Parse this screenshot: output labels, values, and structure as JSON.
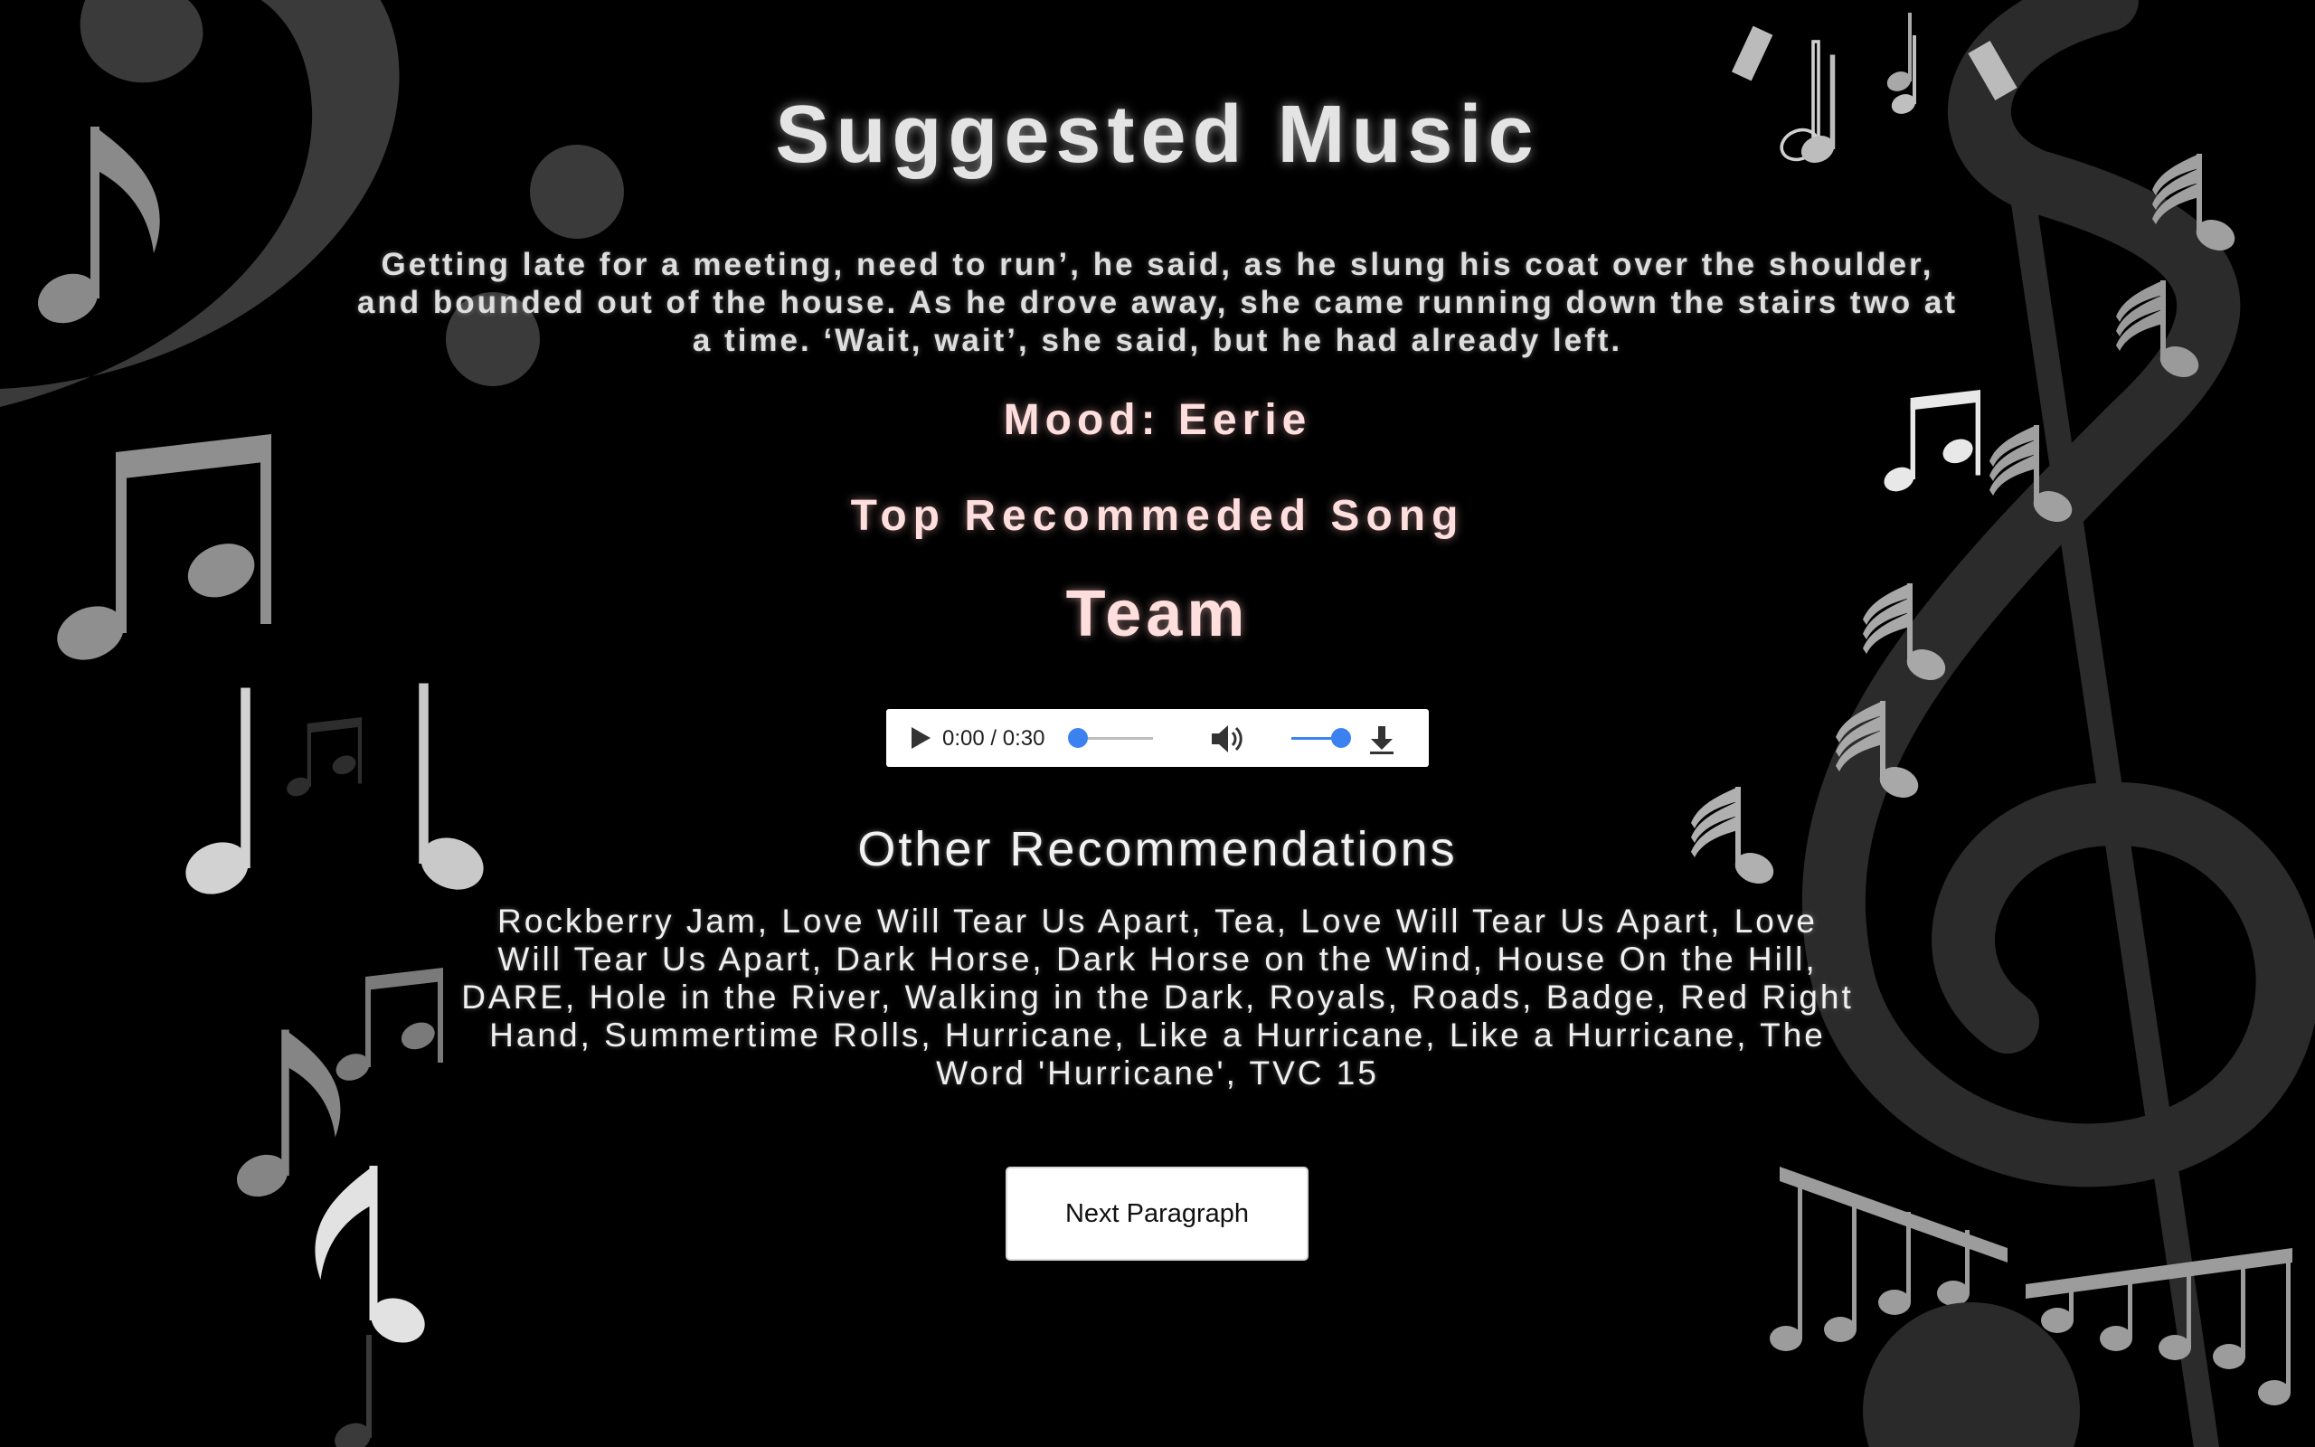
{
  "page": {
    "title": "Suggested Music",
    "paragraph": "Getting late for a meeting, need to run’, he said, as he slung his coat over the shoulder, and bounded out of the house. As he drove away, she came running down the stairs two at a time. ‘Wait, wait’, she said, but he had already left.",
    "mood": "Mood: Eerie",
    "top_song_heading": "Top Recommeded Song",
    "top_song": "Team",
    "other_heading": "Other Recommendations",
    "other_list": "Rockberry Jam, Love Will Tear Us Apart, Tea, Love Will Tear Us Apart, Love Will Tear Us Apart, Dark Horse, Dark Horse on the Wind, House On the Hill, DARE, Hole in the River, Walking in the Dark, Royals, Roads, Badge, Red Right Hand, Summertime Rolls, Hurricane, Like a Hurricane, Like a Hurricane, The Word 'Hurricane', TVC 15",
    "next_button": "Next Paragraph"
  },
  "audio_player": {
    "time": "0:00 / 0:30",
    "progress": 0.0,
    "volume": 1.0,
    "icons": [
      "play-icon",
      "volume-icon",
      "download-icon"
    ],
    "accent_color": "#3b82f0"
  },
  "colors": {
    "background": "#000000",
    "title_text": "#e4e4e4",
    "highlight_text": "#ffdede",
    "body_text": "#f0f0f0"
  },
  "background_decor": [
    "bass-clef-icon",
    "treble-clef-icon",
    "music-note-icon"
  ]
}
